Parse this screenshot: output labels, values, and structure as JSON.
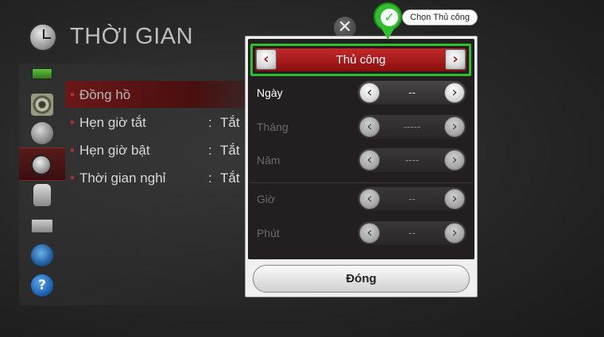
{
  "page": {
    "title": "THỜI GIAN"
  },
  "menu": {
    "items": [
      {
        "label": "Đồng hồ",
        "value": ""
      },
      {
        "label": "Hẹn giờ tắt",
        "value": "Tắt"
      },
      {
        "label": "Hẹn giờ bật",
        "value": "Tắt"
      },
      {
        "label": "Thời gian nghỉ",
        "value": "Tắt"
      }
    ],
    "separator": ":"
  },
  "sidebar": {
    "icons": [
      "picture-icon",
      "sound-icon",
      "channel-icon",
      "time-icon",
      "lock-icon",
      "option-icon",
      "network-icon",
      "support-icon"
    ],
    "support_glyph": "?"
  },
  "dialog": {
    "mode": {
      "label": "Thủ công",
      "left_arrow": "‹",
      "right_arrow": "›"
    },
    "fields": [
      {
        "label": "Ngày",
        "value": "--",
        "enabled": true
      },
      {
        "label": "Tháng",
        "value": "-----",
        "enabled": false
      },
      {
        "label": "Năm",
        "value": "----",
        "enabled": false
      },
      {
        "label": "Giờ",
        "value": "--",
        "enabled": false
      },
      {
        "label": "Phút",
        "value": "--",
        "enabled": false
      }
    ],
    "arrow_left": "‹",
    "arrow_right": "›",
    "close_label": "Đóng",
    "close_x": "✕"
  },
  "callout": {
    "label": "Chọn Thủ công",
    "check": "✓"
  },
  "colors": {
    "accent_red": "#b01a1a",
    "highlight_green": "#2dbd2d"
  }
}
